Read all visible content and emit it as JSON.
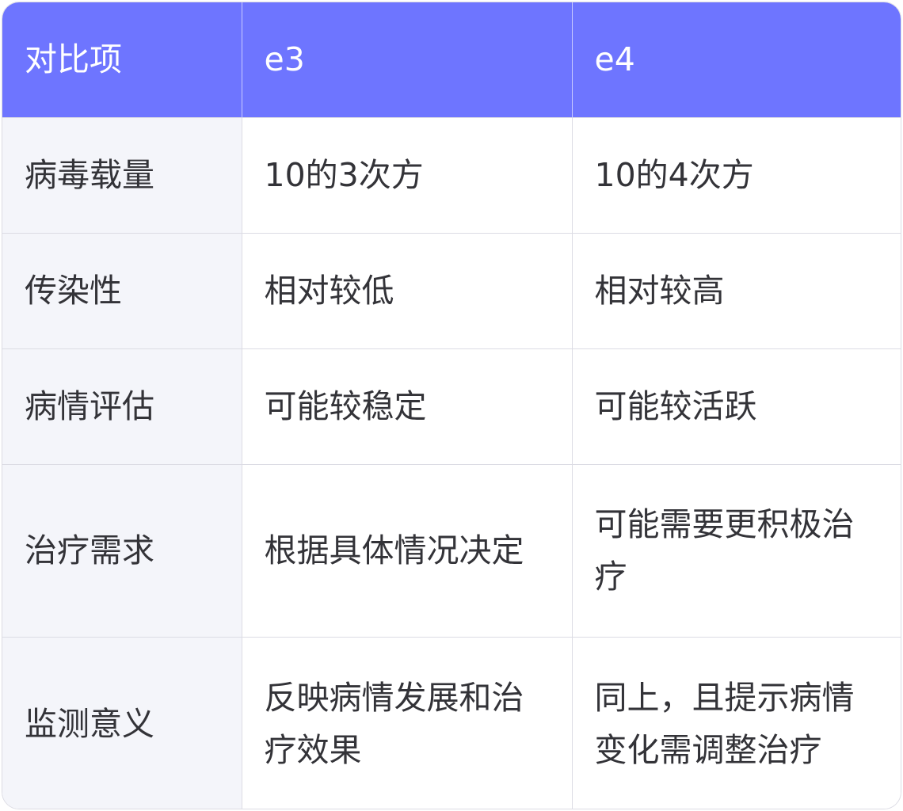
{
  "table": {
    "headers": [
      "对比项",
      "e3",
      "e4"
    ],
    "rows": [
      {
        "item": "病毒载量",
        "e3": "10的3次方",
        "e4": "10的4次方"
      },
      {
        "item": "传染性",
        "e3": "相对较低",
        "e4": "相对较高"
      },
      {
        "item": "病情评估",
        "e3": "可能较稳定",
        "e4": "可能较活跃"
      },
      {
        "item": "治疗需求",
        "e3": "根据具体情况决定",
        "e4": "可能需要更积极治疗"
      },
      {
        "item": "监测意义",
        "e3": "反映病情发展和治疗效果",
        "e4": "同上，且提示病情变化需调整治疗"
      }
    ]
  },
  "colors": {
    "header_bg": "#6e75ff",
    "header_text": "#ffffff",
    "row_head_bg": "#f4f5fa",
    "body_text": "#333338",
    "border": "#dcdce4"
  }
}
